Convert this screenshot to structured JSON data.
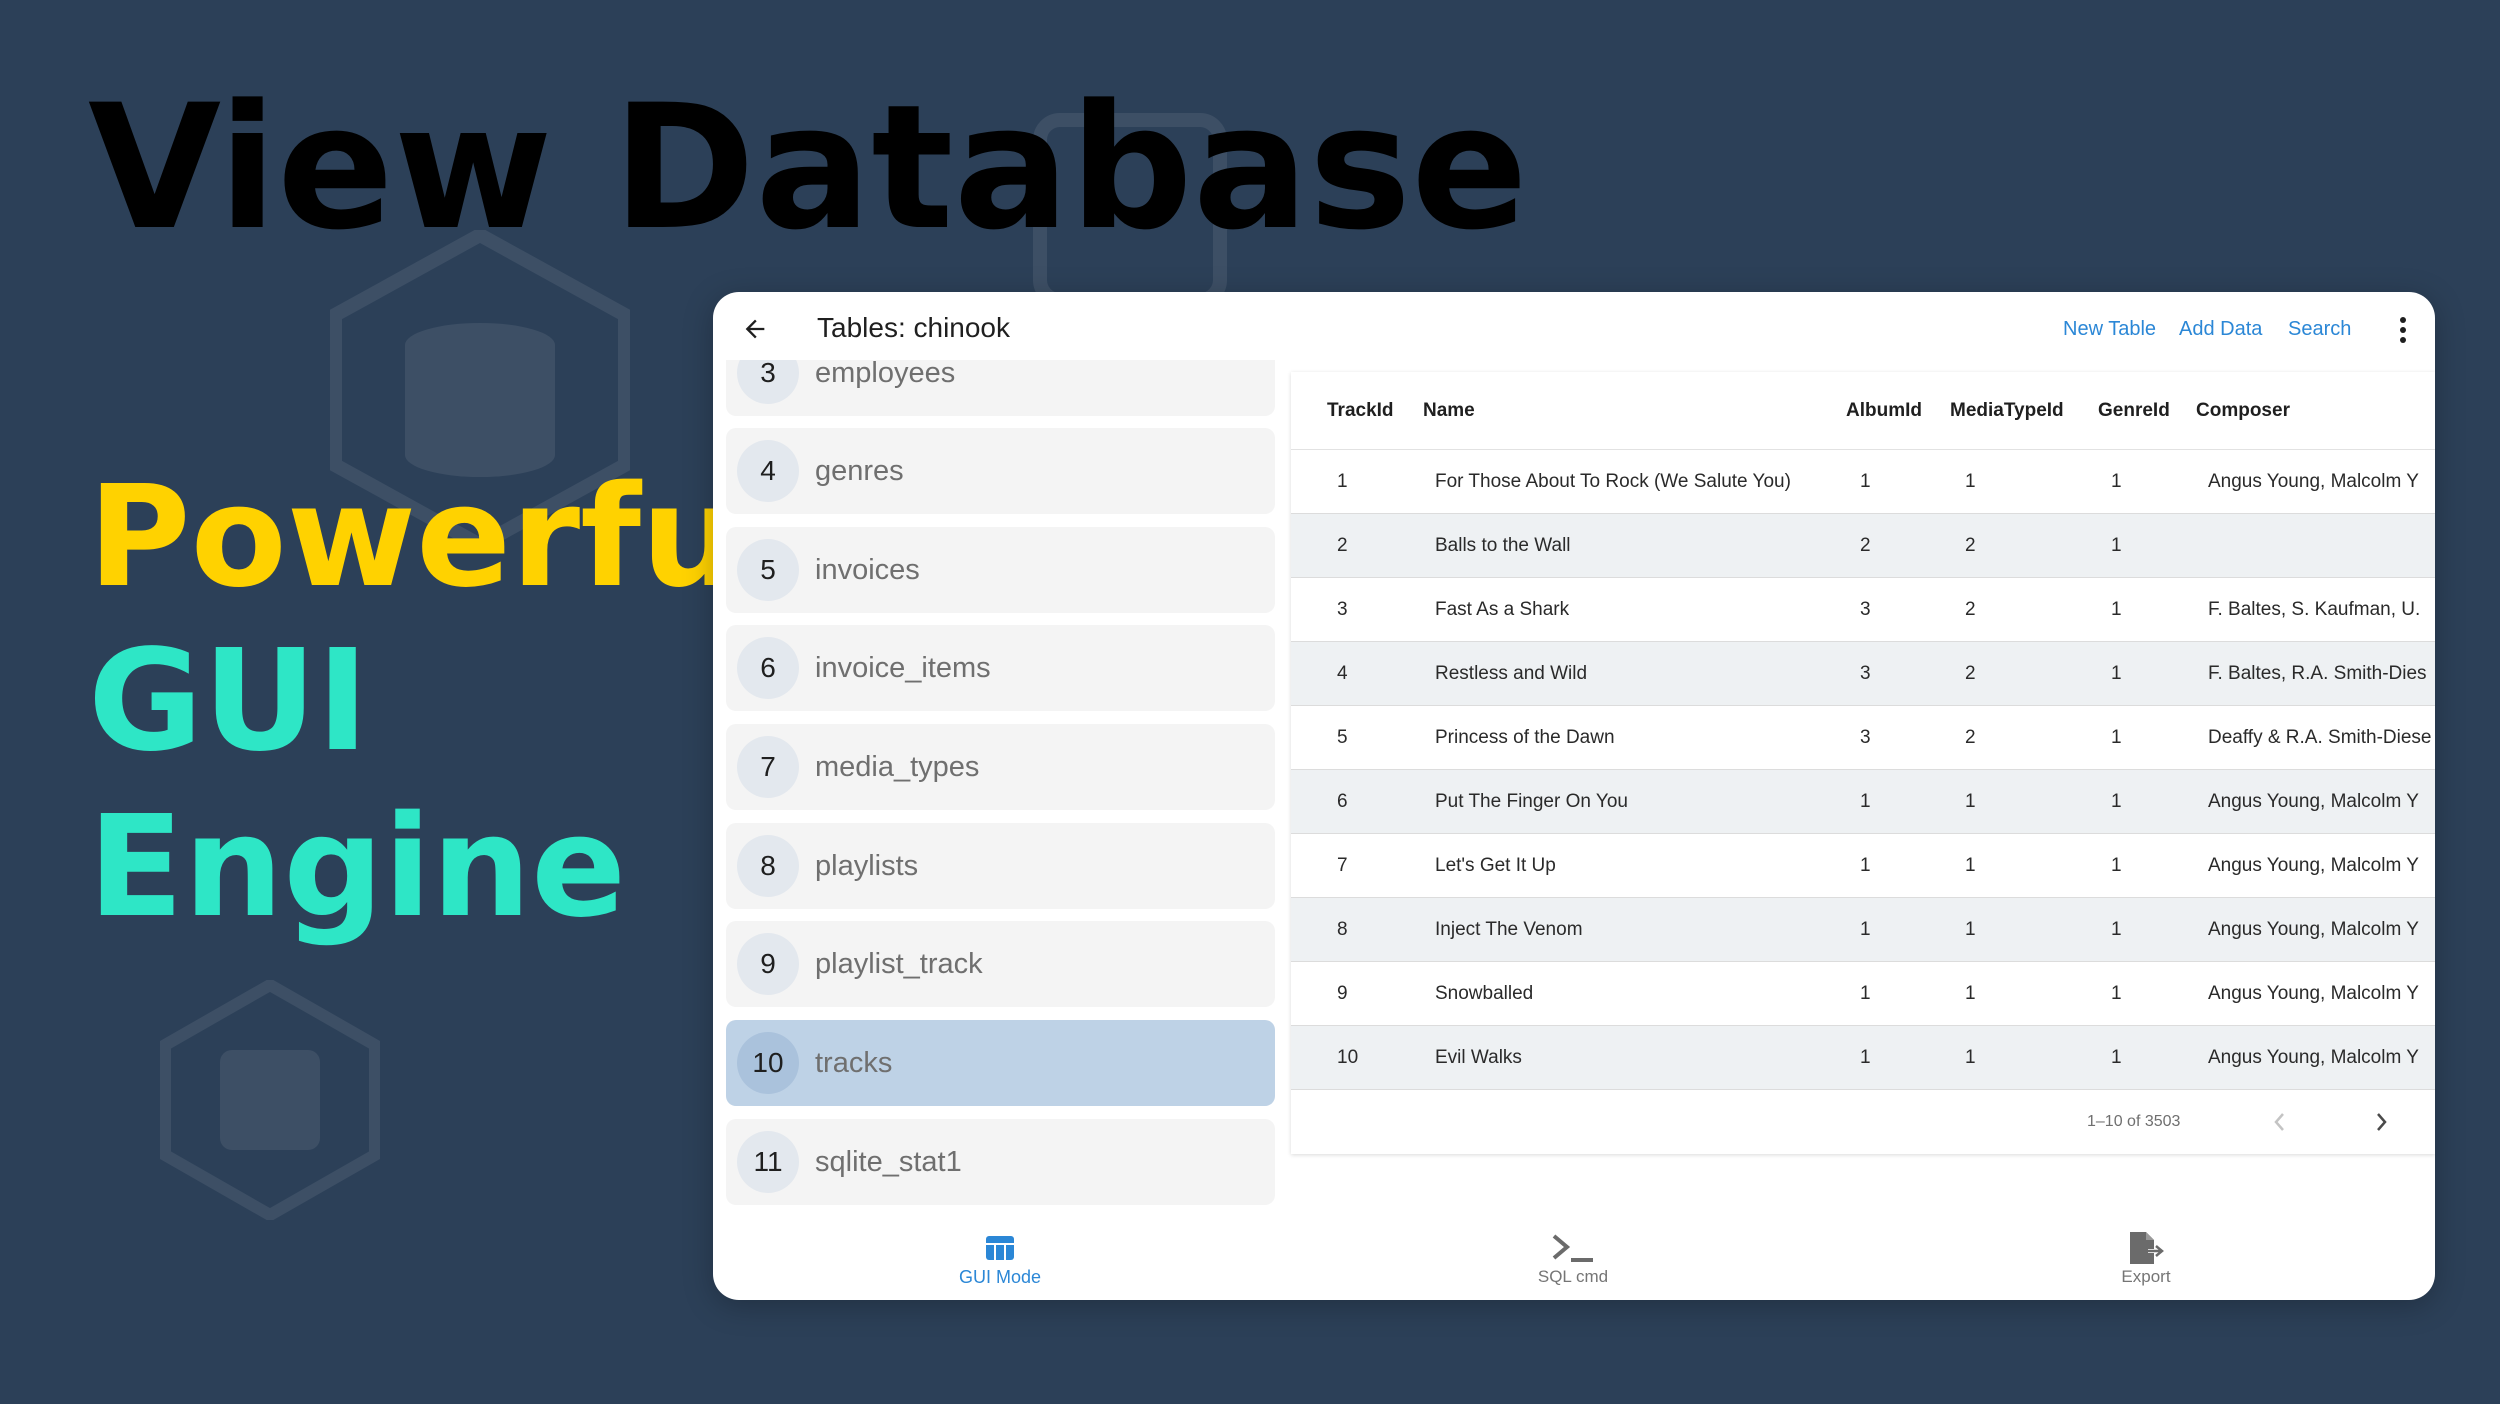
{
  "promo": {
    "line1_white": "View",
    "line1_yellow": "Database",
    "line2": "Powerful",
    "line3": "GUI",
    "line4": "Engine"
  },
  "colors": {
    "background": "#2c4058",
    "yellow": "#ffd200",
    "teal": "#2ee6c6",
    "accent": "#2b87d6",
    "selected_row": "#bed2e6"
  },
  "appbar": {
    "title": "Tables: chinook",
    "actions": {
      "new_table": "New Table",
      "add_data": "Add Data",
      "search": "Search"
    },
    "back_icon": "arrow-left-icon",
    "more_icon": "more-vertical-icon"
  },
  "tables": [
    {
      "num": "3",
      "name": "employees"
    },
    {
      "num": "4",
      "name": "genres"
    },
    {
      "num": "5",
      "name": "invoices"
    },
    {
      "num": "6",
      "name": "invoice_items"
    },
    {
      "num": "7",
      "name": "media_types"
    },
    {
      "num": "8",
      "name": "playlists"
    },
    {
      "num": "9",
      "name": "playlist_track"
    },
    {
      "num": "10",
      "name": "tracks"
    },
    {
      "num": "11",
      "name": "sqlite_stat1"
    }
  ],
  "selected_table": "tracks",
  "grid": {
    "columns": [
      "TrackId",
      "Name",
      "AlbumId",
      "MediaTypeId",
      "GenreId",
      "Composer"
    ],
    "rows": [
      [
        "1",
        "For Those About To Rock (We Salute You)",
        "1",
        "1",
        "1",
        "Angus Young, Malcolm Y"
      ],
      [
        "2",
        "Balls to the Wall",
        "2",
        "2",
        "1",
        ""
      ],
      [
        "3",
        "Fast As a Shark",
        "3",
        "2",
        "1",
        "F. Baltes, S. Kaufman, U."
      ],
      [
        "4",
        "Restless and Wild",
        "3",
        "2",
        "1",
        "F. Baltes, R.A. Smith-Dies"
      ],
      [
        "5",
        "Princess of the Dawn",
        "3",
        "2",
        "1",
        "Deaffy & R.A. Smith-Diese"
      ],
      [
        "6",
        "Put The Finger On You",
        "1",
        "1",
        "1",
        "Angus Young, Malcolm Y"
      ],
      [
        "7",
        "Let's Get It Up",
        "1",
        "1",
        "1",
        "Angus Young, Malcolm Y"
      ],
      [
        "8",
        "Inject The Venom",
        "1",
        "1",
        "1",
        "Angus Young, Malcolm Y"
      ],
      [
        "9",
        "Snowballed",
        "1",
        "1",
        "1",
        "Angus Young, Malcolm Y"
      ],
      [
        "10",
        "Evil Walks",
        "1",
        "1",
        "1",
        "Angus Young, Malcolm Y"
      ]
    ],
    "page_range": "1–10 of 3503"
  },
  "bottom_nav": [
    {
      "label": "GUI Mode",
      "icon": "table-icon",
      "active": true
    },
    {
      "label": "SQL cmd",
      "icon": "terminal-icon",
      "active": false
    },
    {
      "label": "Export",
      "icon": "export-file-icon",
      "active": false
    }
  ]
}
